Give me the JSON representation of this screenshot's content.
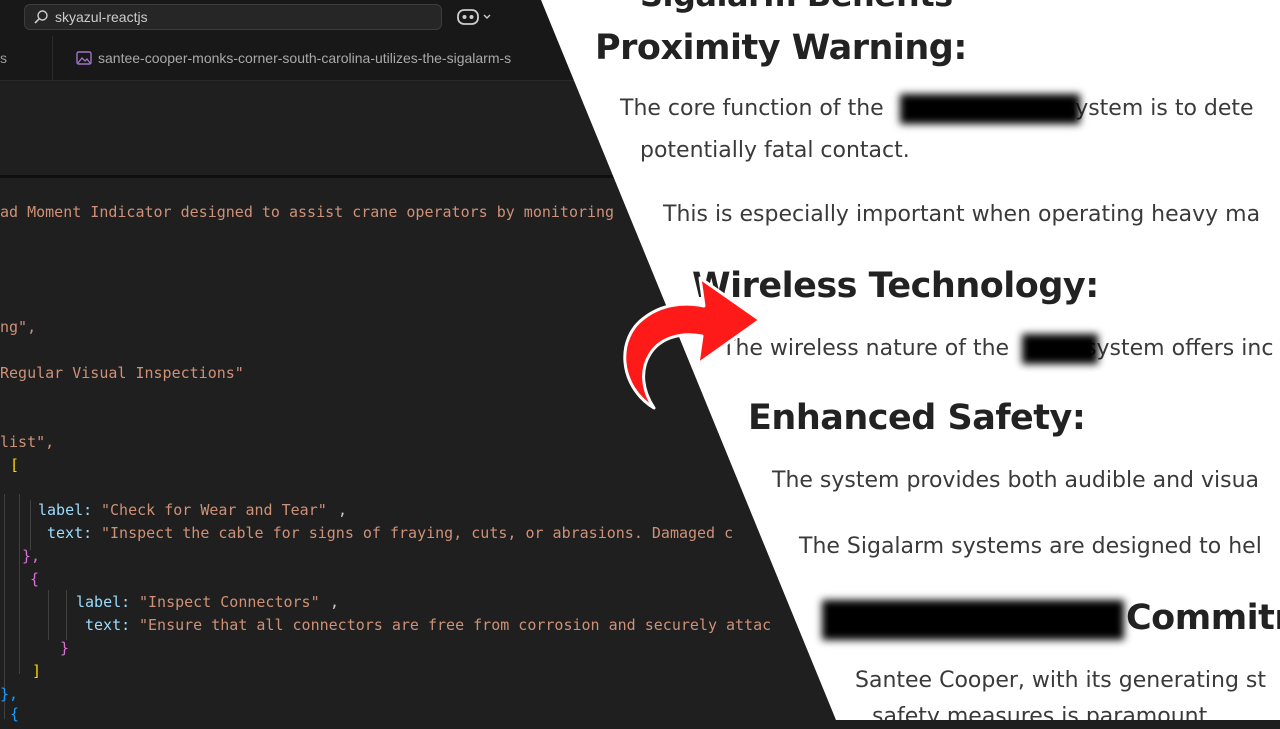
{
  "editor": {
    "search_text": "skyazul-reactjs",
    "tabs": {
      "left_label": "s",
      "active_label": "santee-cooper-monks-corner-south-carolina-utilizes-the-sigalarm-s"
    },
    "code_lines": {
      "l1": "ad Moment Indicator designed to assist crane operators by monitoring",
      "l2": "ng\",",
      "l3": "Regular Visual Inspections\"",
      "l4": "list\",",
      "l5_bracket": "[",
      "l6_key": "label:",
      "l6_val": "\"Check for Wear and Tear\"",
      "l7_key": "text:",
      "l7_val": "\"Inspect the cable for signs of fraying, cuts, or abrasions. Damaged c",
      "l8": "},",
      "l9": "{",
      "l10_key": "label:",
      "l10_val": "\"Inspect Connectors\"",
      "l11_key": "text:",
      "l11_val": "\"Ensure that all connectors are free from corrosion and securely attac",
      "l12": "}",
      "l13": "]",
      "l14": "},",
      "l15": "{"
    }
  },
  "article": {
    "h_top": "Sigalarm Benefits",
    "h_proximity": "Proximity Warning:",
    "p_proximity_1a": "The core function of the",
    "p_proximity_1b": "system is to dete",
    "p_proximity_2": "potentially fatal contact.",
    "p_important": "This is especially important when operating heavy ma",
    "h_wireless": "Wireless Technology:",
    "p_wireless_a": "The wireless nature of the",
    "p_wireless_b": "system offers inc",
    "h_safety": "Enhanced Safety:",
    "p_safety": "The system provides both audible and visua",
    "p_sigalarm": "The Sigalarm systems are designed to hel",
    "h_commit": "Commitm",
    "p_santee": "Santee Cooper, with its generating st",
    "p_safety_measures": "safety measures is paramount"
  },
  "colors": {
    "arrow": "#ff1a1a",
    "string": "#ce9178",
    "key": "#9cdcfe",
    "bracket_gold": "#ffd700",
    "bracket_violet": "#da70d6",
    "bracket_blue": "#179fff"
  }
}
